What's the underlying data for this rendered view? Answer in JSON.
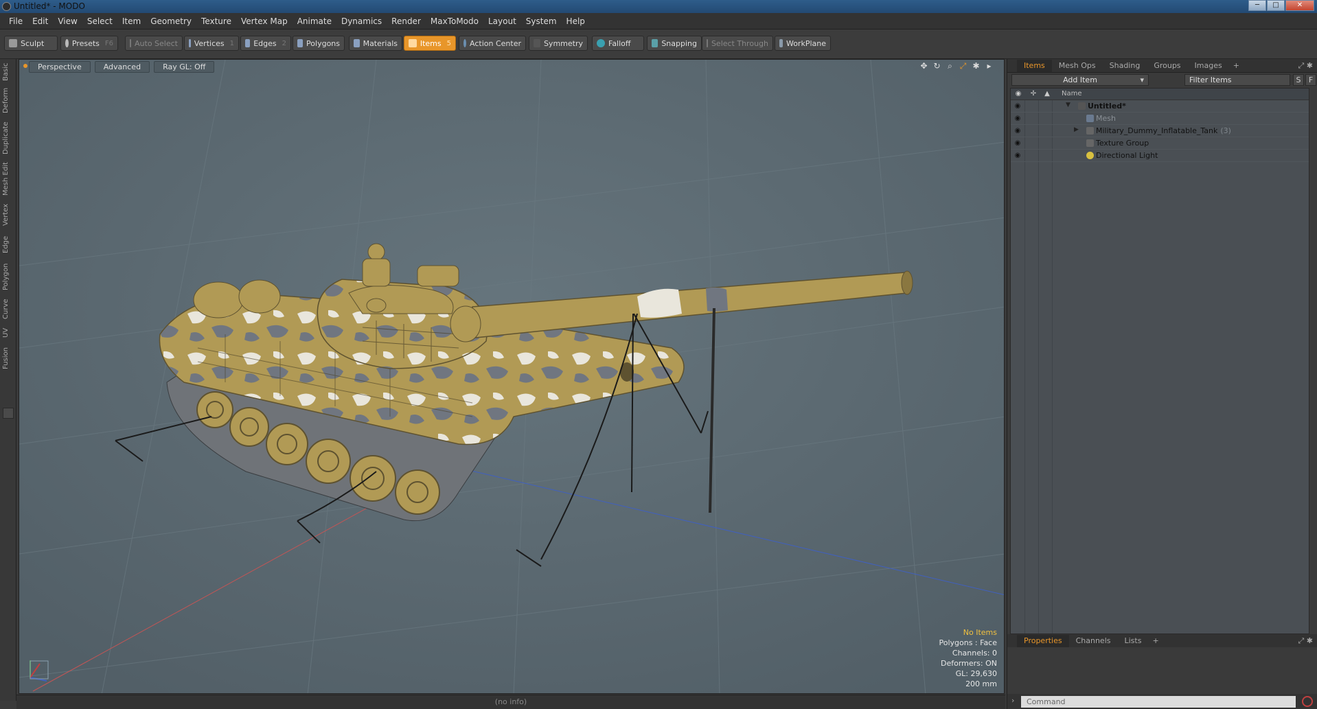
{
  "window": {
    "title": "Untitled* - MODO"
  },
  "menu": [
    "File",
    "Edit",
    "View",
    "Select",
    "Item",
    "Geometry",
    "Texture",
    "Vertex Map",
    "Animate",
    "Dynamics",
    "Render",
    "MaxToModo",
    "Layout",
    "System",
    "Help"
  ],
  "toolbar": {
    "sculpt": "Sculpt",
    "presets": "Presets",
    "presets_key": "F6",
    "auto_select": "Auto Select",
    "vertices": "Vertices",
    "vertices_key": "1",
    "edges": "Edges",
    "edges_key": "2",
    "polygons": "Polygons",
    "materials": "Materials",
    "items": "Items",
    "items_key": "5",
    "action_center": "Action Center",
    "symmetry": "Symmetry",
    "falloff": "Falloff",
    "snapping": "Snapping",
    "select_through": "Select Through",
    "workplane": "WorkPlane"
  },
  "left_tabs": [
    "Basic",
    "Deform",
    "Duplicate",
    "Mesh Edit",
    "Vertex",
    "Edge",
    "Polygon",
    "Curve",
    "UV",
    "Fusion"
  ],
  "viewport": {
    "view": "Perspective",
    "shading": "Advanced",
    "raygl": "Ray GL: Off",
    "stats": {
      "selection": "No Items",
      "polygons": "Polygons : Face",
      "channels": "Channels: 0",
      "deformers": "Deformers: ON",
      "gl": "GL: 29,630",
      "scale": "200 mm"
    }
  },
  "status": "(no info)",
  "right_panel": {
    "tabs": [
      "Items",
      "Mesh Ops",
      "Shading",
      "Groups",
      "Images"
    ],
    "add_item": "Add Item",
    "filter_placeholder": "Filter Items",
    "s_btn": "S",
    "f_btn": "F",
    "name_header": "Name",
    "tree": [
      {
        "label": "Untitled*",
        "count": ""
      },
      {
        "label": "Mesh",
        "count": ""
      },
      {
        "label": "Military_Dummy_Inflatable_Tank",
        "count": "(3)"
      },
      {
        "label": "Texture Group",
        "count": ""
      },
      {
        "label": "Directional Light",
        "count": ""
      }
    ],
    "bottom_tabs": [
      "Properties",
      "Channels",
      "Lists"
    ],
    "command_placeholder": "Command"
  },
  "colors": {
    "accent": "#e8962a",
    "viewport_bg": "#5b6a72",
    "tank_olive": "#b19a55",
    "tank_white": "#e9e6dc",
    "tank_gray": "#707680"
  }
}
